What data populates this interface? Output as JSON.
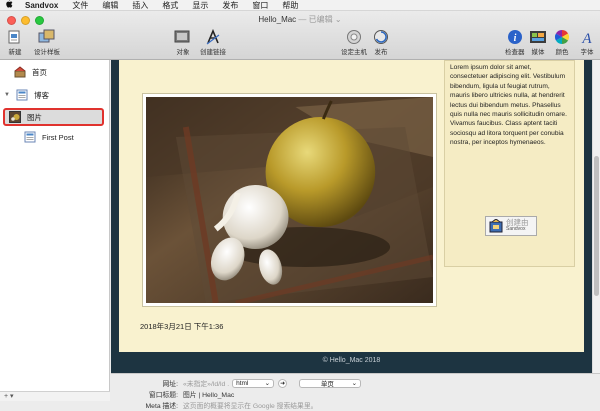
{
  "menubar": {
    "app": "Sandvox",
    "items": [
      "文件",
      "编辑",
      "插入",
      "格式",
      "显示",
      "发布",
      "窗口",
      "帮助"
    ]
  },
  "window": {
    "title": "Hello_Mac",
    "status": "— 已编辑"
  },
  "toolbar": {
    "new": "新建",
    "design": "设计样板",
    "object": "对象",
    "create_link": "创建链接",
    "setup_host": "设定主机",
    "publish": "发布",
    "inspector": "检查器",
    "media": "媒体",
    "colors": "颜色",
    "fonts": "字体"
  },
  "sidebar": {
    "home": "首页",
    "blog": "博客",
    "picture": "图片",
    "first_post": "First Post"
  },
  "page": {
    "date": "2018年3月21日 下午1:36",
    "lorem": "Lorem ipsum dolor sit amet, consectetuer adipiscing elit. Vestibulum bibendum, ligula ut feugiat rutrum, mauris libero ultricies nulla, at hendrerit lectus dui bibendum metus. Phasellus quis nulla nec mauris sollicitudin ornare. Vivamus faucibus. Class aptent taciti sociosqu ad litora torquent per conubia nostra, per inceptos hymenaeos.",
    "badge_line1": "创建由",
    "badge_line2": "Sandvox",
    "footer": "© Hello_Mac 2018"
  },
  "props": {
    "url_label": "网址:",
    "url_value": "«未指定»/ld/ld .",
    "ext": "html",
    "page_type": "单页",
    "window_title_label": "窗口标题:",
    "window_title_value": "图片 | Hello_Mac",
    "meta_label": "Meta 描述:",
    "meta_placeholder": "这页面的概要将显示在 Google 搜索结果里。"
  },
  "colors": {
    "accent_red": "#e0322e",
    "page_bg": "#f9f2cf",
    "canvas_bg": "#1d3441"
  }
}
